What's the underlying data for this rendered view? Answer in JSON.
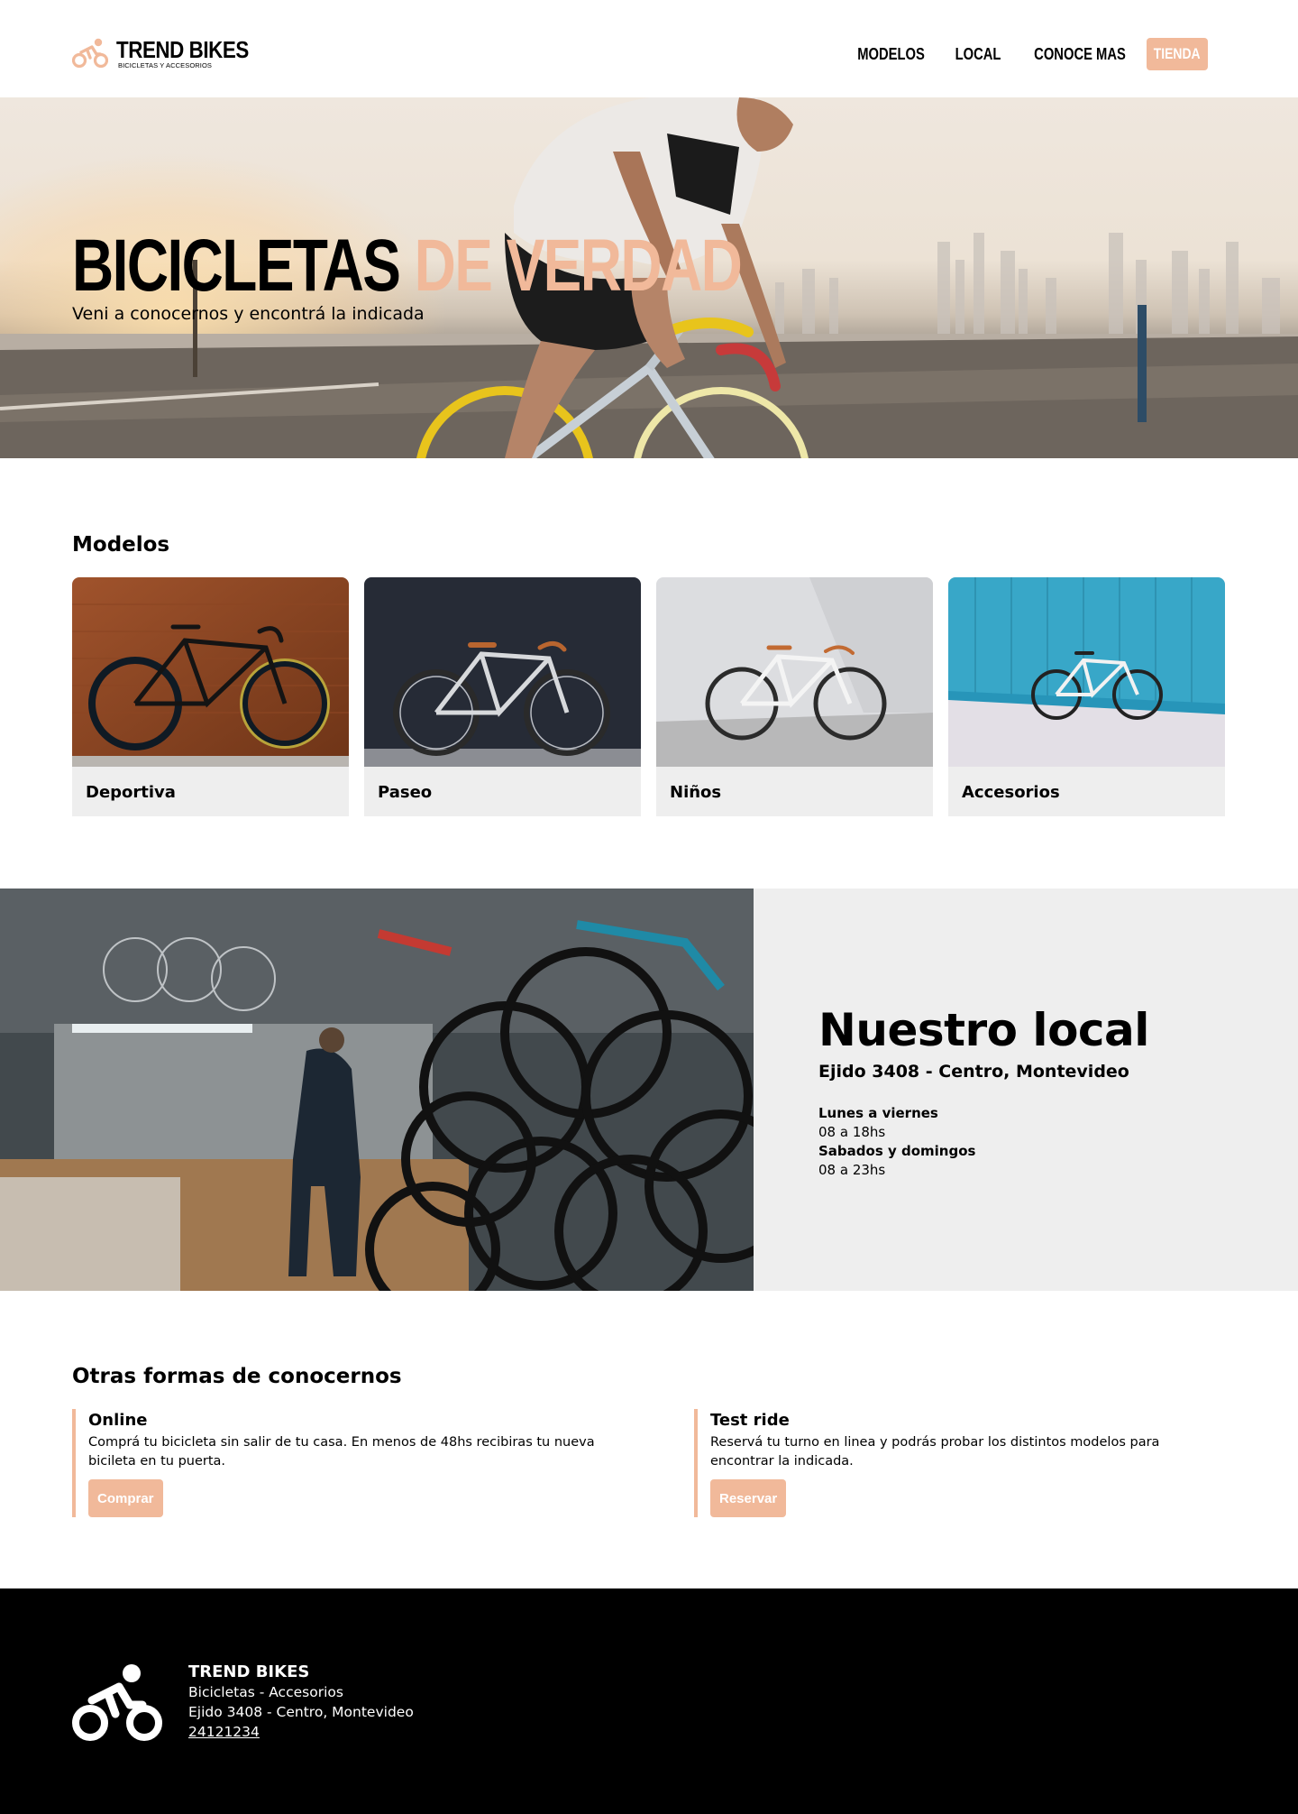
{
  "brand": {
    "name": "TREND BIKES",
    "tagline": "BICICLETAS Y ACCESORIOS",
    "accent_color": "#f1b99a",
    "logo_icon": "cyclist-icon"
  },
  "nav": {
    "items": [
      {
        "label": "MODELOS"
      },
      {
        "label": "LOCAL"
      },
      {
        "label": "CONOCE MAS"
      }
    ],
    "cta_label": "TIENDA"
  },
  "hero": {
    "title_part1": "BICICLETAS",
    "title_part2": "DE VERDAD",
    "subtitle": "Veni a conocernos y encontrá la indicada",
    "image": "cyclist-riding-photo"
  },
  "models": {
    "title": "Modelos",
    "items": [
      {
        "label": "Deportiva",
        "image": "road-bike-photo"
      },
      {
        "label": "Paseo",
        "image": "city-bike-photo"
      },
      {
        "label": "Niños",
        "image": "white-bike-photo"
      },
      {
        "label": "Accesorios",
        "image": "blue-wall-bike-photo"
      }
    ]
  },
  "local": {
    "title": "Nuestro local",
    "address": "Ejido 3408 - Centro, Montevideo",
    "hours": [
      {
        "days": "Lunes a viernes",
        "time": "08 a 18hs"
      },
      {
        "days": "Sabados y domingos",
        "time": "08 a 23hs"
      }
    ],
    "image": "bike-shop-interior-photo"
  },
  "other": {
    "title": "Otras formas de conocernos",
    "items": [
      {
        "title": "Online",
        "text": "Comprá tu bicicleta sin salir de tu casa. En menos de 48hs recibiras tu nueva bicileta en tu puerta.",
        "button": "Comprar"
      },
      {
        "title": "Test ride",
        "text": "Reservá tu turno en linea y podrás probar los distintos modelos para encontrar la indicada.",
        "button": "Reservar"
      }
    ]
  },
  "footer": {
    "name": "TREND BIKES",
    "line1": "Bicicletas - Accesorios",
    "line2": "Ejido 3408 - Centro, Montevideo",
    "phone": "24121234",
    "logo_icon": "cyclist-icon"
  }
}
